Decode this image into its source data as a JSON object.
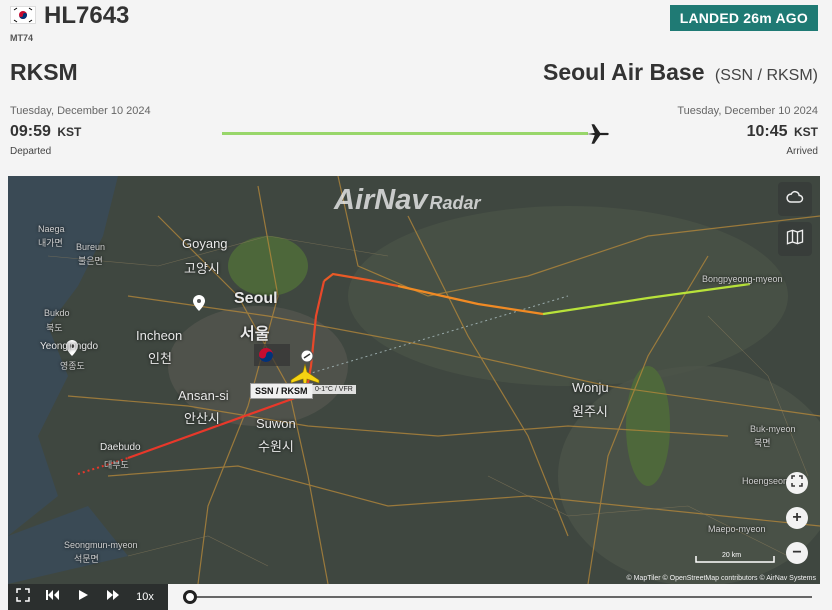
{
  "flight": {
    "registration": "HL7643",
    "aircraft_type": "MT74",
    "status": "LANDED 26m AGO"
  },
  "departure": {
    "code": "RKSM",
    "date": "Tuesday, December 10 2024",
    "time": "09:59",
    "tz": "KST",
    "label": "Departed"
  },
  "arrival": {
    "name": "Seoul Air Base",
    "codes": "(SSN / RKSM)",
    "date": "Tuesday, December 10 2024",
    "time": "10:45",
    "tz": "KST",
    "label": "Arrived"
  },
  "progress": {
    "fraction": 1.0
  },
  "map": {
    "watermark": "AirNav",
    "watermark_sub": "Radar",
    "airport_label": "SSN / RKSM",
    "weather_label": "0-1°C / VFR",
    "scale_label": "20 km",
    "attribution": "© MapTiler © OpenStreetMap contributors © AirNav Systems",
    "places": [
      {
        "name": "Goyang"
      },
      {
        "name": "고양시"
      },
      {
        "name": "Seoul"
      },
      {
        "name": "서울"
      },
      {
        "name": "Incheon"
      },
      {
        "name": "인천"
      },
      {
        "name": "Ansan-si"
      },
      {
        "name": "안산시"
      },
      {
        "name": "Suwon"
      },
      {
        "name": "수원시"
      },
      {
        "name": "Wonju"
      },
      {
        "name": "원주시"
      },
      {
        "name": "Yeongjongdo"
      },
      {
        "name": "영종도"
      },
      {
        "name": "Daebudo"
      },
      {
        "name": "대부도"
      },
      {
        "name": "Bukdo"
      },
      {
        "name": "북도"
      },
      {
        "name": "Naega"
      },
      {
        "name": "내가면"
      },
      {
        "name": "Bureun"
      },
      {
        "name": "불은면"
      },
      {
        "name": "Seongmun-myeon"
      },
      {
        "name": "석문면"
      },
      {
        "name": "Bongpyeong-myeon"
      },
      {
        "name": "Buk-myeon"
      },
      {
        "name": "북면"
      },
      {
        "name": "Maepo-myeon"
      },
      {
        "name": "Hoengseong"
      }
    ],
    "colors": {
      "track_start": "#e8382a",
      "track_mid": "#f08a24",
      "track_end": "#b8e23a",
      "aircraft": "#f5d312",
      "status_bg": "#1f7a74"
    }
  },
  "player": {
    "speed": "10x",
    "playback_fraction": 0.0
  },
  "icons": {
    "flag": "south-korea-flag-icon",
    "weather": "cloud-icon",
    "layers": "map-layers-icon",
    "fullscreen": "fullscreen-icon",
    "zoom_in": "plus-icon",
    "zoom_out": "minus-icon",
    "plane": "airplane-icon"
  }
}
